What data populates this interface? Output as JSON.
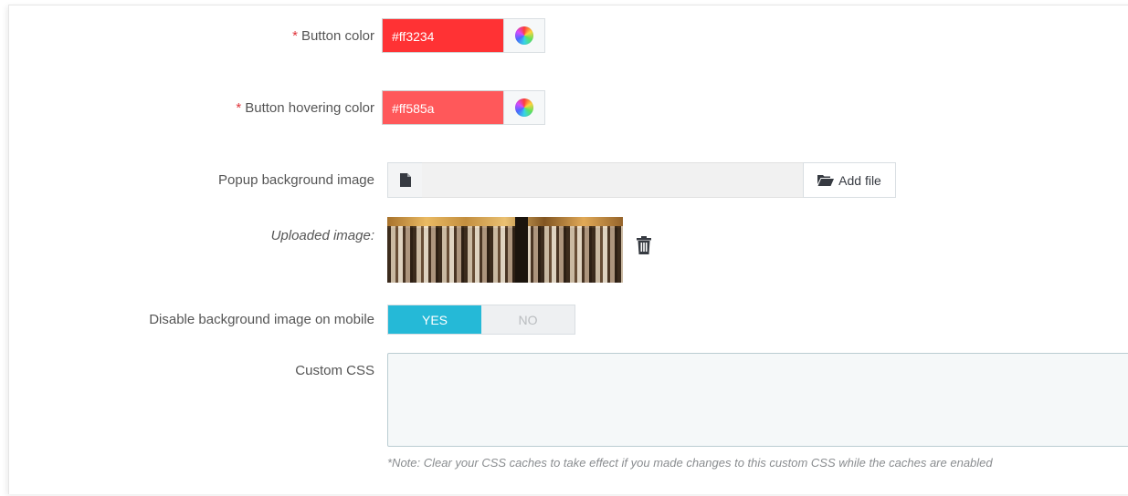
{
  "fields": {
    "button_color": {
      "required_mark": "*",
      "label": "Button color",
      "value": "#ff3234",
      "swatch": "#ff3234"
    },
    "button_hover_color": {
      "required_mark": "*",
      "label": "Button hovering color",
      "value": "#ff585a",
      "swatch": "#ff585a"
    },
    "popup_bg_image": {
      "label": "Popup background image",
      "add_file_label": "Add file"
    },
    "uploaded_image": {
      "label": "Uploaded image:"
    },
    "disable_bg_mobile": {
      "label": "Disable background image on mobile",
      "yes_label": "YES",
      "no_label": "NO",
      "selected": "YES"
    },
    "custom_css": {
      "label": "Custom CSS",
      "value": "",
      "note": "*Note: Clear your CSS caches to take effect if you made changes to this custom CSS while the caches are enabled"
    }
  },
  "icons": {
    "color_picker": "color-wheel-icon",
    "file": "file-icon",
    "add_file": "folder-open-icon",
    "delete": "trash-icon"
  },
  "colors": {
    "toggle_on": "#25b9d7",
    "required": "#e0333a"
  }
}
